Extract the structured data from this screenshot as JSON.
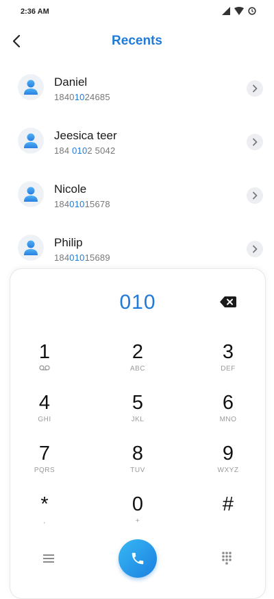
{
  "status_bar": {
    "time": "2:36 AM",
    "icons": [
      "signal-icon",
      "wifi-icon",
      "alarm-icon"
    ]
  },
  "header": {
    "title": "Recents"
  },
  "recents": [
    {
      "name": "Daniel",
      "number_parts": [
        "1840",
        "10",
        "24685"
      ]
    },
    {
      "name": "Jeesica teer",
      "number_parts": [
        "184 ",
        "010",
        "2 5042"
      ]
    },
    {
      "name": "Nicole",
      "number_parts": [
        "184",
        "010",
        "15678"
      ]
    },
    {
      "name": "Philip",
      "number_parts": [
        "184",
        "010",
        "15689"
      ]
    }
  ],
  "dialpad": {
    "display": "010",
    "keys": [
      {
        "digit": "1",
        "letters": ""
      },
      {
        "digit": "2",
        "letters": "ABC"
      },
      {
        "digit": "3",
        "letters": "DEF"
      },
      {
        "digit": "4",
        "letters": "GHI"
      },
      {
        "digit": "5",
        "letters": "JKL"
      },
      {
        "digit": "6",
        "letters": "MNO"
      },
      {
        "digit": "7",
        "letters": "PQRS"
      },
      {
        "digit": "8",
        "letters": "TUV"
      },
      {
        "digit": "9",
        "letters": "WXYZ"
      },
      {
        "digit": "*",
        "letters": ","
      },
      {
        "digit": "0",
        "letters": "+"
      },
      {
        "digit": "#",
        "letters": ""
      }
    ]
  },
  "colors": {
    "accent": "#1f7ad8",
    "call_gradient_start": "#37b8f4",
    "call_gradient_end": "#1b7fe0"
  }
}
